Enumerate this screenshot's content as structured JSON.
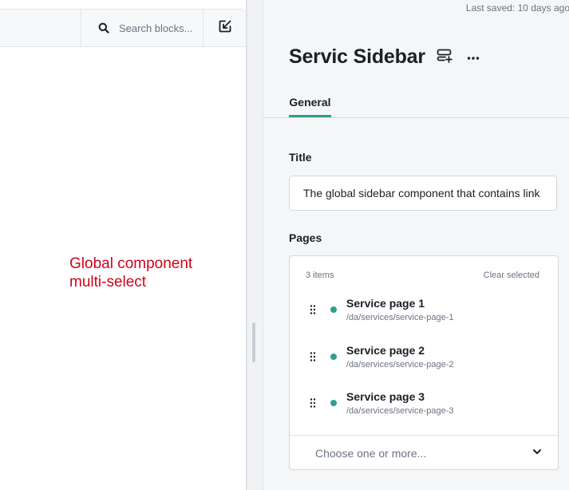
{
  "canvas": {
    "search": {
      "placeholder": "Search blocks..."
    },
    "note": {
      "line1": "Global component",
      "line2": "multi-select"
    }
  },
  "editor": {
    "last_saved": "Last saved: 10 days ago",
    "title": "Servic Sidebar",
    "tabs": [
      {
        "label": "General",
        "active": true
      }
    ],
    "fields": {
      "title": {
        "label": "Title",
        "value": "The global sidebar component that contains link"
      },
      "pages": {
        "label": "Pages",
        "count_label": "3 items",
        "clear_label": "Clear selected",
        "items": [
          {
            "name": "Service page 1",
            "path": "/da/services/service-page-1"
          },
          {
            "name": "Service page 2",
            "path": "/da/services/service-page-2"
          },
          {
            "name": "Service page 3",
            "path": "/da/services/service-page-3"
          }
        ],
        "select_placeholder": "Choose one or more..."
      }
    }
  },
  "icons": {
    "search": "search-icon",
    "collapse": "arrow-down-left-icon",
    "add_block": "add-block-icon",
    "more": "more-horizontal-icon",
    "drag": "drag-handle-icon",
    "chevron": "chevron-down-icon"
  },
  "colors": {
    "accent": "#2f9e8f",
    "note_red": "#d0021b",
    "status_dot": "#2f9e8f"
  }
}
